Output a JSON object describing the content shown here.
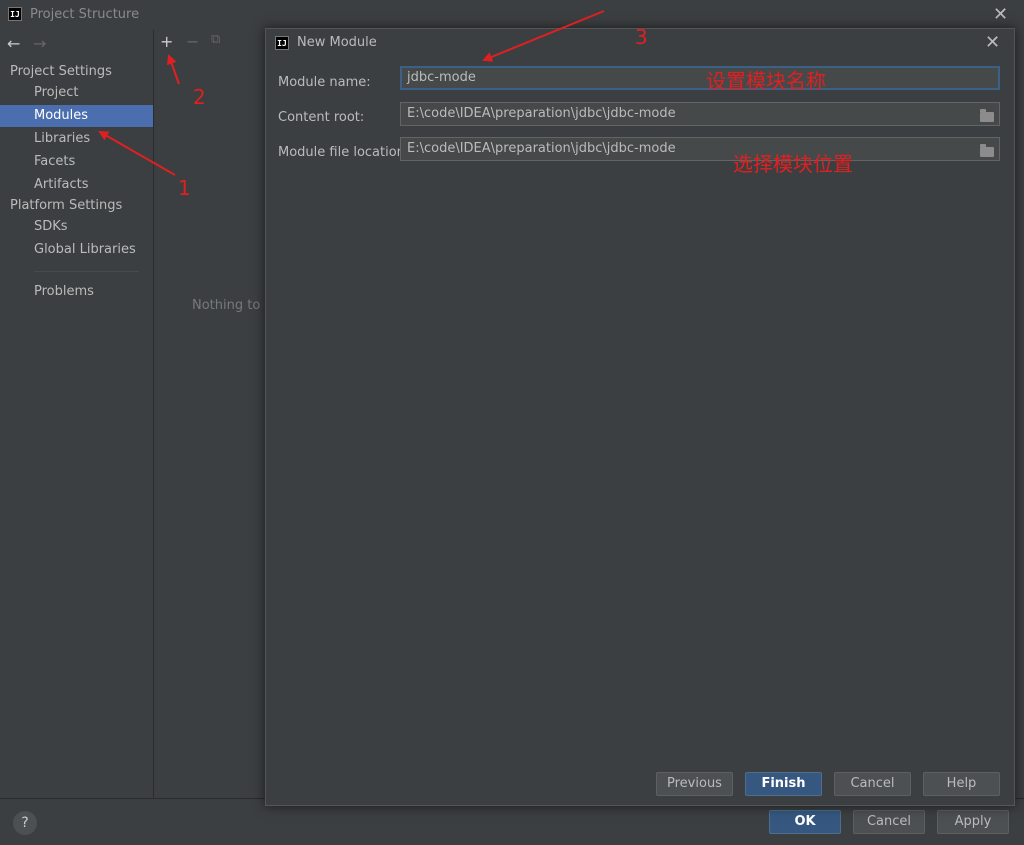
{
  "window": {
    "title": "Project Structure",
    "logo_text": "IJ"
  },
  "sidebar": {
    "project_settings_header": "Project Settings",
    "project_items": [
      {
        "label": "Project",
        "selected": false
      },
      {
        "label": "Modules",
        "selected": true
      },
      {
        "label": "Libraries",
        "selected": false
      },
      {
        "label": "Facets",
        "selected": false
      },
      {
        "label": "Artifacts",
        "selected": false
      }
    ],
    "platform_settings_header": "Platform Settings",
    "platform_items": [
      {
        "label": "SDKs"
      },
      {
        "label": "Global Libraries"
      }
    ],
    "problems_label": "Problems"
  },
  "toolbar": {
    "add": "+",
    "remove": "−",
    "copy": "⧉"
  },
  "middle": {
    "empty_text": "Nothing to s"
  },
  "dialog": {
    "title": "New Module",
    "module_name_label": "Module name:",
    "module_name_value": "jdbc-mode",
    "content_root_label": "Content root:",
    "content_root_value": "E:\\code\\IDEA\\preparation\\jdbc\\jdbc-mode",
    "module_file_location_label": "Module file location:",
    "module_file_location_value": "E:\\code\\IDEA\\preparation\\jdbc\\jdbc-mode",
    "buttons": {
      "previous": "Previous",
      "finish": "Finish",
      "cancel": "Cancel",
      "help": "Help"
    }
  },
  "footer": {
    "help": "?",
    "ok": "OK",
    "cancel": "Cancel",
    "apply": "Apply"
  },
  "annotations": {
    "step1": "1",
    "step2": "2",
    "step3": "3",
    "set_module_name": "设置模块名称",
    "choose_module_location": "选择模块位置",
    "color": "#e02020"
  },
  "colors": {
    "background": "#3c3f41",
    "selection": "#4b6eaf",
    "primary_button": "#365880"
  }
}
